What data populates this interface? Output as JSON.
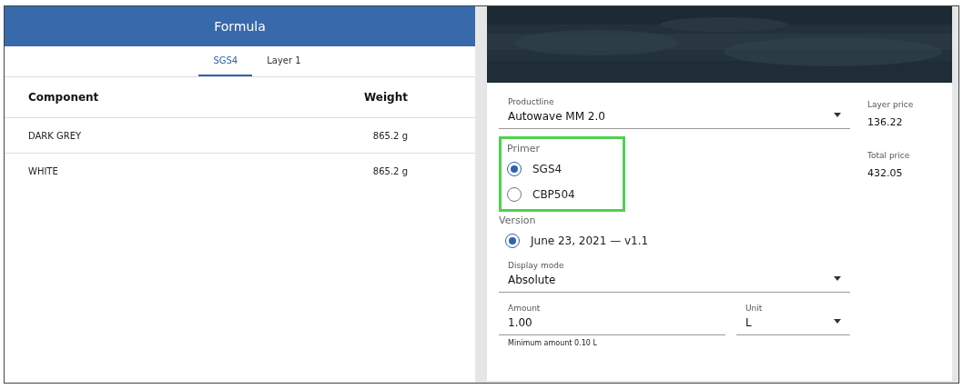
{
  "formula": {
    "title": "Formula",
    "tabs": [
      {
        "label": "SGS4",
        "selected": true
      },
      {
        "label": "Layer 1",
        "selected": false
      }
    ],
    "columns": [
      "Component",
      "Weight"
    ],
    "rows": [
      {
        "component": "DARK GREY",
        "weight": "865.2 g"
      },
      {
        "component": "WHITE",
        "weight": "865.2 g"
      }
    ]
  },
  "details": {
    "productline": {
      "label": "Productline",
      "value": "Autowave MM 2.0"
    },
    "primer": {
      "label": "Primer",
      "highlighted": true,
      "options": [
        {
          "label": "SGS4",
          "selected": true
        },
        {
          "label": "CBP504",
          "selected": false
        }
      ]
    },
    "version": {
      "label": "Version",
      "options": [
        {
          "label": "June 23, 2021 — v1.1",
          "selected": true
        }
      ]
    },
    "display_mode": {
      "label": "Display mode",
      "value": "Absolute"
    },
    "amount": {
      "label": "Amount",
      "value": "1.00",
      "hint": "Minimum amount 0.10 L"
    },
    "unit": {
      "label": "Unit",
      "value": "L"
    },
    "prices": [
      {
        "label": "Layer price",
        "value": "136.22"
      },
      {
        "label": "Total price",
        "value": "432.05"
      }
    ]
  }
}
